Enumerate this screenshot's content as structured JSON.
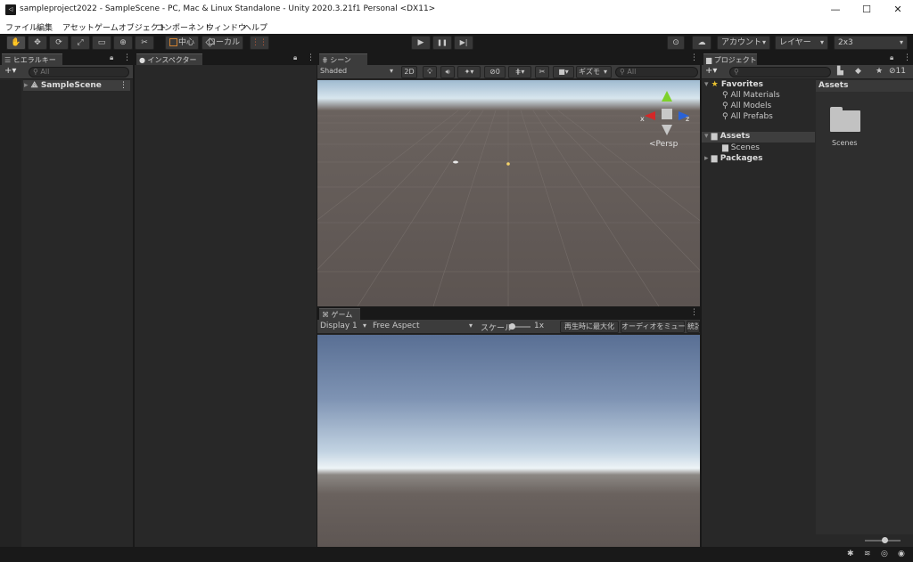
{
  "window": {
    "title": "sampleproject2022 - SampleScene - PC, Mac & Linux Standalone - Unity 2020.3.21f1 Personal <DX11>",
    "app_icon": "◁",
    "minimize": "—",
    "maximize": "☐",
    "close": "✕"
  },
  "menu": [
    "ファイル",
    "編集",
    "アセット",
    "ゲームオブジェクト",
    "コンポーネント",
    "ウィンドウ",
    "ヘルプ"
  ],
  "toolbar": {
    "tools": [
      "✋",
      "✥",
      "⟳",
      "⤢",
      "▭",
      "⊕",
      "✂"
    ],
    "pivot_label": "中心",
    "space_label": "ローカル",
    "snap_icon": "⋮⋮",
    "play_icon": "▶",
    "pause_icon": "❚❚",
    "step_icon": "▶|",
    "collab_icon": "⊙",
    "cloud_icon": "☁",
    "account_label": "アカウント",
    "layers_label": "レイヤー",
    "layout_label": "2x3"
  },
  "hierarchy": {
    "tab_label": "ヒエラルキー",
    "add_label": "+▾",
    "search_placeholder": "All",
    "scene_name": "SampleScene"
  },
  "inspector": {
    "tab_label": "インスペクター"
  },
  "scene_view": {
    "tab_label": "シーン",
    "shading_mode": "Shaded",
    "mode_2d": "2D",
    "hidden_count": "0",
    "gizmos_label": "ギズモ",
    "search_placeholder": "All",
    "persp_label": "Persp",
    "axis_x": "x",
    "axis_z": "z"
  },
  "game_view": {
    "tab_label": "ゲーム",
    "display_label": "Display 1",
    "aspect_label": "Free Aspect",
    "scale_label": "スケール",
    "scale_value": "1x",
    "maximize_label": "再生時に最大化",
    "mute_label": "オーディオをミュート",
    "stats_label": "統計"
  },
  "project": {
    "tab_label": "プロジェクト",
    "add_label": "+▾",
    "hidden_count": "11",
    "favorites_label": "Favorites",
    "favorites_items": [
      "All Materials",
      "All Models",
      "All Prefabs"
    ],
    "assets_label": "Assets",
    "assets_children": [
      "Scenes"
    ],
    "packages_label": "Packages",
    "breadcrumb": "Assets",
    "folder_items": [
      "Scenes"
    ]
  },
  "colors": {
    "panel_bg": "#282828",
    "toolbar_bg": "#191919",
    "tab_bg": "#3c3c3c",
    "selection_bg": "#3e3e3e",
    "axis_y": "#7ed12b",
    "axis_x": "#d42828",
    "axis_z": "#2a62d6"
  }
}
